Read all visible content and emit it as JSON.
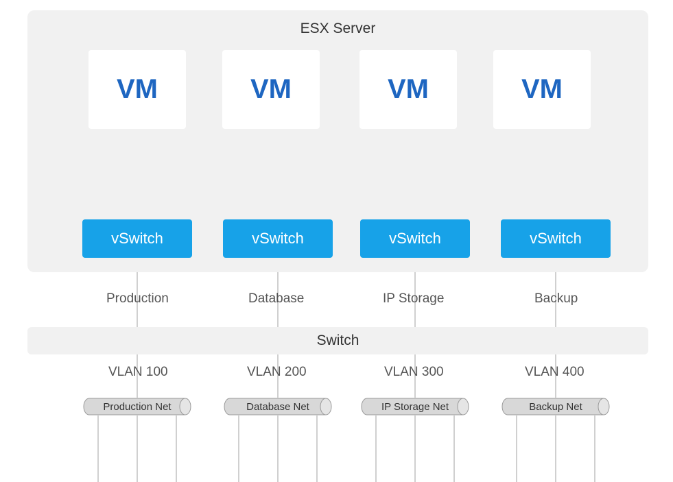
{
  "diagram": {
    "esx_title": "ESX Server",
    "switch_label": "Switch",
    "vms": [
      "VM",
      "VM",
      "VM",
      "VM"
    ],
    "vswitches": [
      "vSwitch",
      "vSwitch",
      "vSwitch",
      "vSwitch"
    ],
    "net_labels": [
      "Production",
      "Database",
      "IP Storage",
      "Backup"
    ],
    "vlans": [
      "VLAN 100",
      "VLAN 200",
      "VLAN 300",
      "VLAN 400"
    ],
    "pipes": [
      "Production Net",
      "Database Net",
      "IP Storage Net",
      "Backup Net"
    ]
  },
  "colors": {
    "panel_bg": "#f1f1f1",
    "vm_text": "#1e66c1",
    "vswitch_bg": "#17a2e8",
    "pipe_fill": "#d0d0d0",
    "pipe_stroke": "#9a9a9a",
    "line": "#a0a0a0"
  }
}
